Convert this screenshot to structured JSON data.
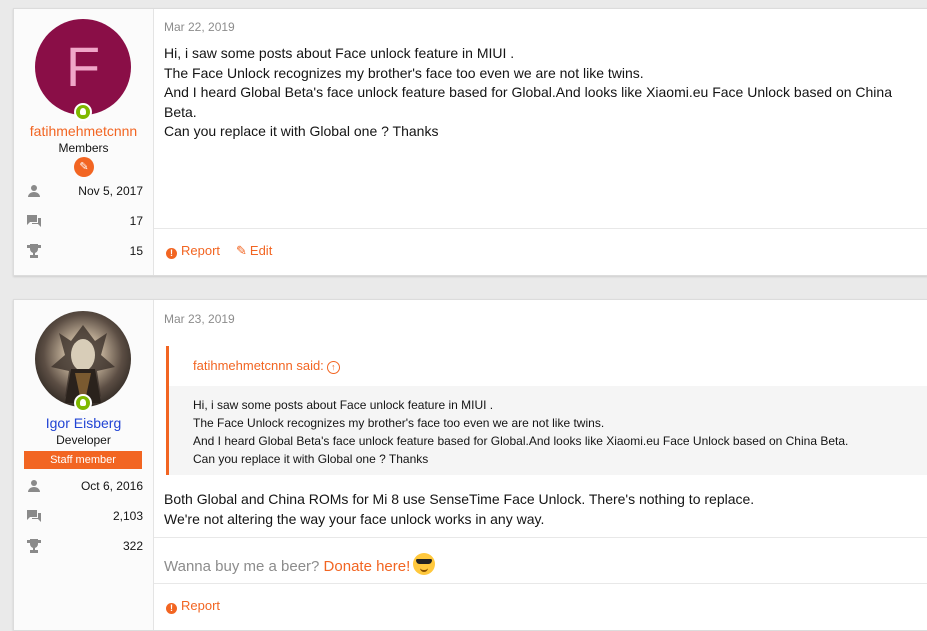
{
  "posts": [
    {
      "avatar_letter": "F",
      "username": "fatihmehmetcnnn",
      "user_title": "Members",
      "badge_icon": "member-badge-icon",
      "stats": [
        {
          "icon": "user-icon",
          "value": "Nov 5, 2017"
        },
        {
          "icon": "messages-icon",
          "value": "17"
        },
        {
          "icon": "trophy-icon",
          "value": "15"
        }
      ],
      "date": "Mar 22, 2019",
      "body_lines": [
        "Hi, i saw some posts about Face unlock feature in MIUI .",
        "The Face Unlock recognizes my brother's face too even we are not like twins.",
        "And I heard Global Beta's face unlock feature based for Global.And looks like Xiaomi.eu Face Unlock based on China Beta.",
        "Can you replace it with Global one ? Thanks"
      ],
      "actions": {
        "report": "Report",
        "edit": "Edit"
      }
    },
    {
      "username": "Igor Eisberg",
      "user_title": "Developer",
      "staff_badge": "Staff member",
      "stats": [
        {
          "icon": "user-icon",
          "value": "Oct 6, 2016"
        },
        {
          "icon": "messages-icon",
          "value": "2,103"
        },
        {
          "icon": "trophy-icon",
          "value": "322"
        }
      ],
      "date": "Mar 23, 2019",
      "quote": {
        "author": "fatihmehmetcnnn said:",
        "lines": [
          "Hi, i saw some posts about Face unlock feature in MIUI .",
          "The Face Unlock recognizes my brother's face too even we are not like twins.",
          "And I heard Global Beta's face unlock feature based for Global.And looks like Xiaomi.eu Face Unlock based on China Beta.",
          "Can you replace it with Global one ? Thanks"
        ]
      },
      "body_lines": [
        "Both Global and China ROMs for Mi 8 use SenseTime Face Unlock. There's nothing to replace.",
        "We're not altering the way your face unlock works in any way."
      ],
      "signature": {
        "text": "Wanna buy me a beer? ",
        "link": "Donate here!",
        "emoji": "sunglasses-emoji"
      },
      "actions": {
        "report": "Report"
      }
    }
  ],
  "colors": {
    "accent": "#f26522",
    "staff_name": "#2144d4",
    "online": "#7fb900"
  }
}
